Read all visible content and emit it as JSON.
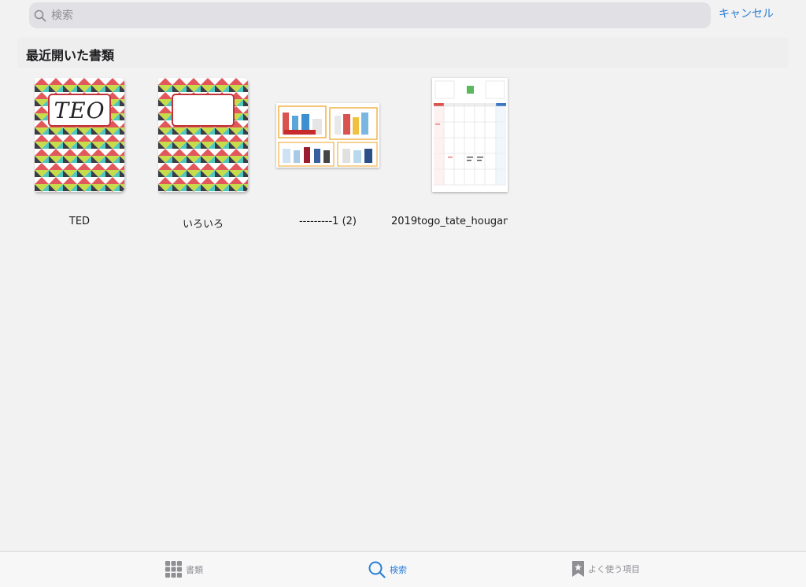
{
  "search": {
    "placeholder": "検索",
    "cancel_label": "キャンセル"
  },
  "section": {
    "title": "最近開いた書類"
  },
  "documents": [
    {
      "name": "TED",
      "cover_text": "TEO"
    },
    {
      "name": "いろいろ",
      "cover_text": ""
    },
    {
      "name": "---------1 (2)"
    },
    {
      "name": "2019togo_tate_hougan"
    }
  ],
  "tabbar": {
    "items": [
      {
        "label": "書類",
        "icon": "grid-icon"
      },
      {
        "label": "検索",
        "icon": "search-icon"
      },
      {
        "label": "よく使う項目",
        "icon": "bookmark-star-icon"
      }
    ]
  },
  "colors": {
    "accent": "#2c7fd6",
    "cover_red": "#e2575c",
    "cover_teal": "#4fc6c0",
    "cover_lime": "#c6dc4a",
    "cover_dark": "#3c3c44"
  }
}
